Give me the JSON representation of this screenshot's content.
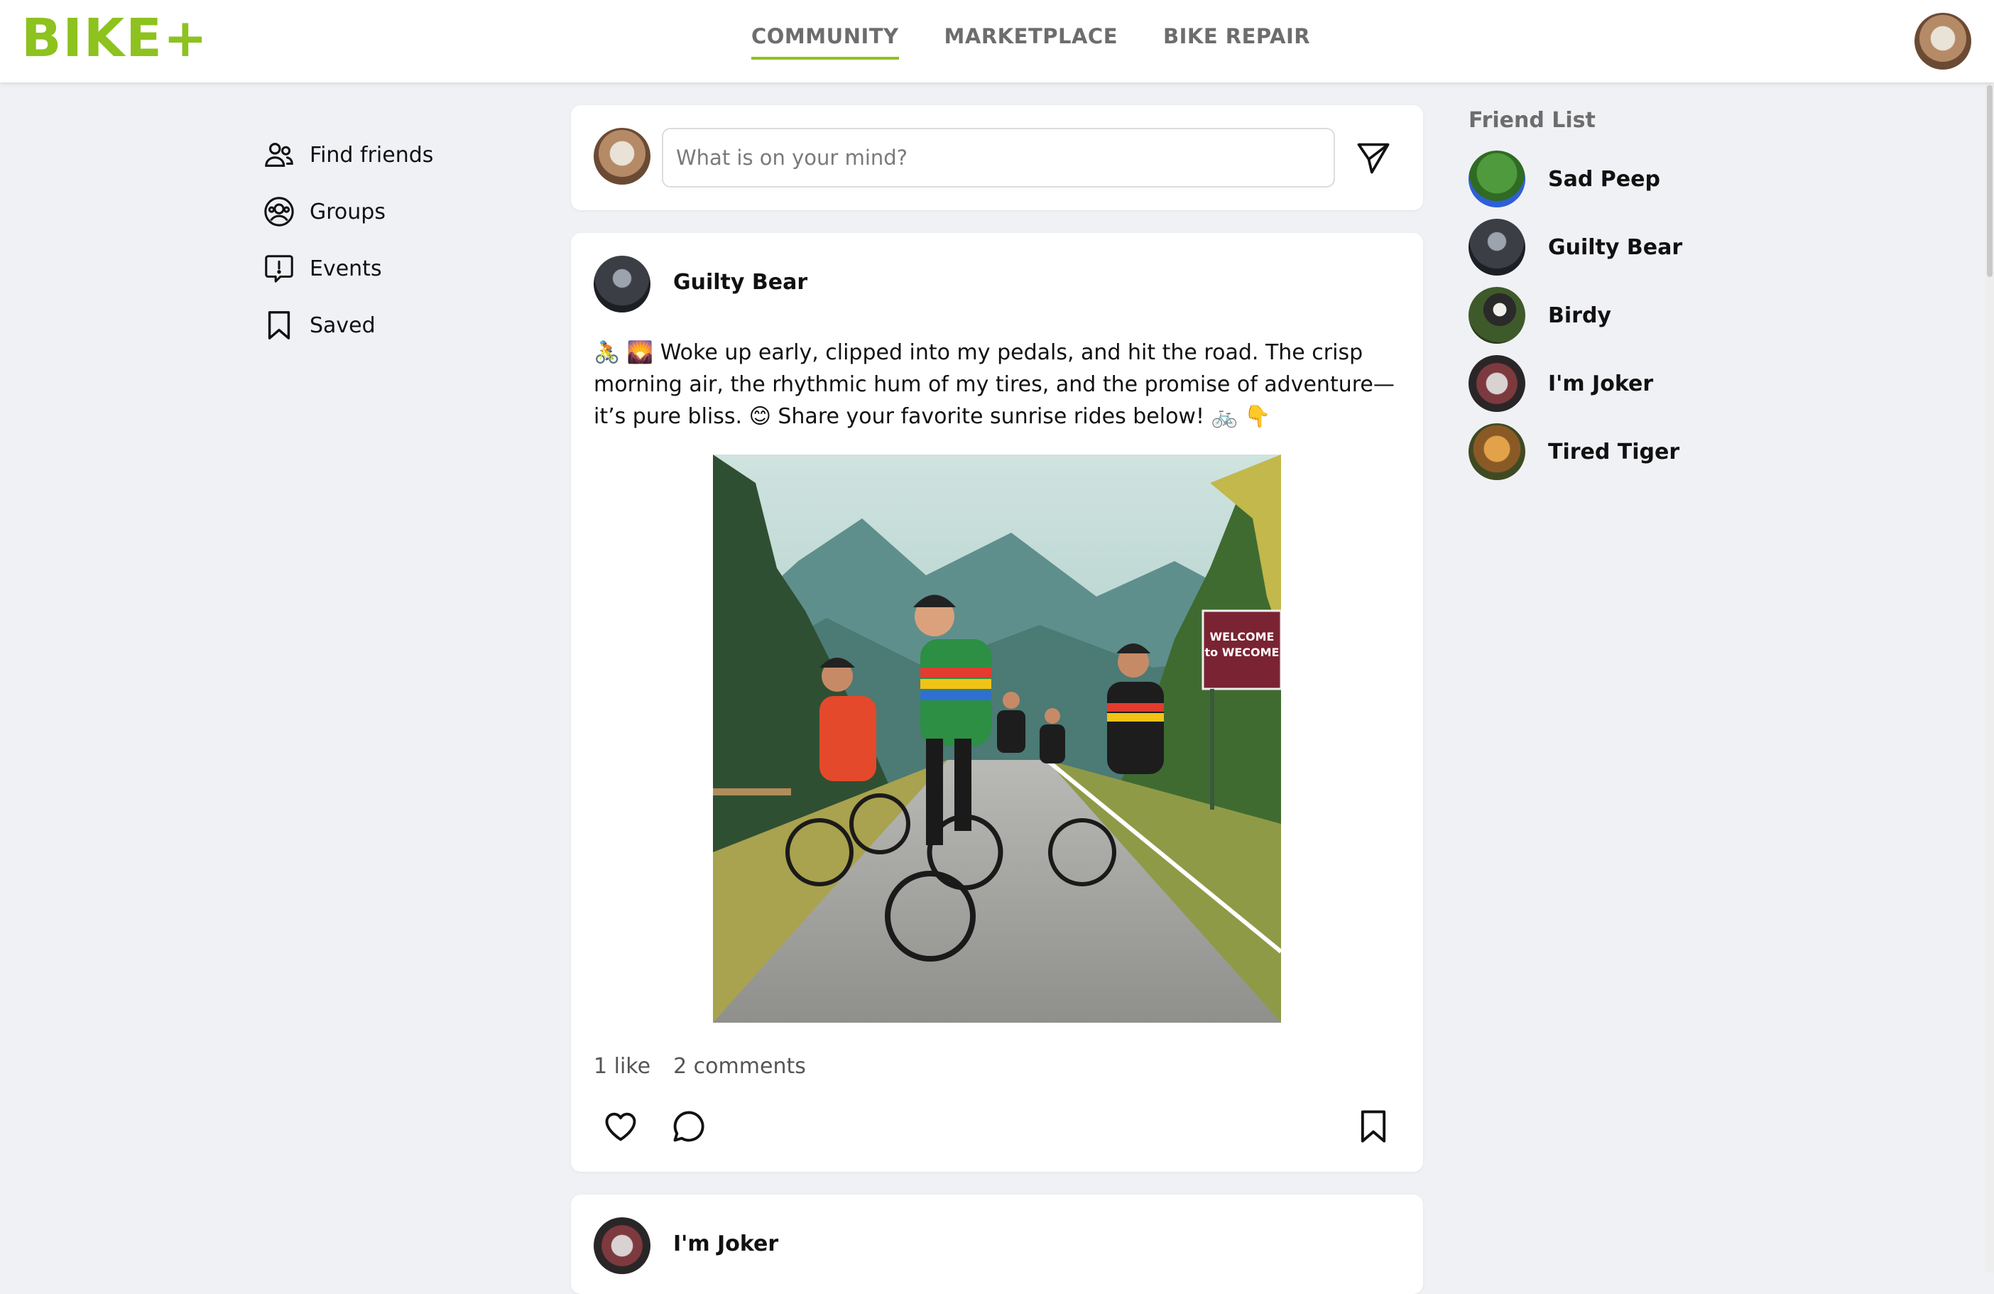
{
  "brand": {
    "logo_text": "BIKE+",
    "accent_color": "#8dc21f"
  },
  "nav": {
    "items": [
      {
        "label": "COMMUNITY",
        "active": true
      },
      {
        "label": "MARKETPLACE",
        "active": false
      },
      {
        "label": "BIKE REPAIR",
        "active": false
      }
    ]
  },
  "sidebar": {
    "items": [
      {
        "label": "Find friends",
        "icon": "users-icon"
      },
      {
        "label": "Groups",
        "icon": "group-circle-icon"
      },
      {
        "label": "Events",
        "icon": "alert-message-icon"
      },
      {
        "label": "Saved",
        "icon": "bookmark-icon"
      }
    ]
  },
  "composer": {
    "placeholder": "What is on your mind?",
    "send_icon": "send-icon"
  },
  "posts": [
    {
      "author": "Guilty Bear",
      "text": "🚴 🌄 Woke up early, clipped into my pedals, and hit the road. The crisp morning air, the rhythmic hum of my tires, and the promise of adventure—it’s pure bliss. 😊 Share your favorite sunrise rides below! 🚲 👇",
      "image": {
        "description": "group of road cyclists riding down a mountain road with forest and a welcome sign",
        "sign_text": "WELCOME to WECOME"
      },
      "likes_label": "1 like",
      "comments_label": "2 comments"
    },
    {
      "author": "I'm Joker"
    }
  ],
  "friend_list": {
    "title": "Friend List",
    "friends": [
      {
        "name": "Sad Peep"
      },
      {
        "name": "Guilty Bear"
      },
      {
        "name": "Birdy"
      },
      {
        "name": "I'm Joker"
      },
      {
        "name": "Tired Tiger"
      }
    ]
  }
}
